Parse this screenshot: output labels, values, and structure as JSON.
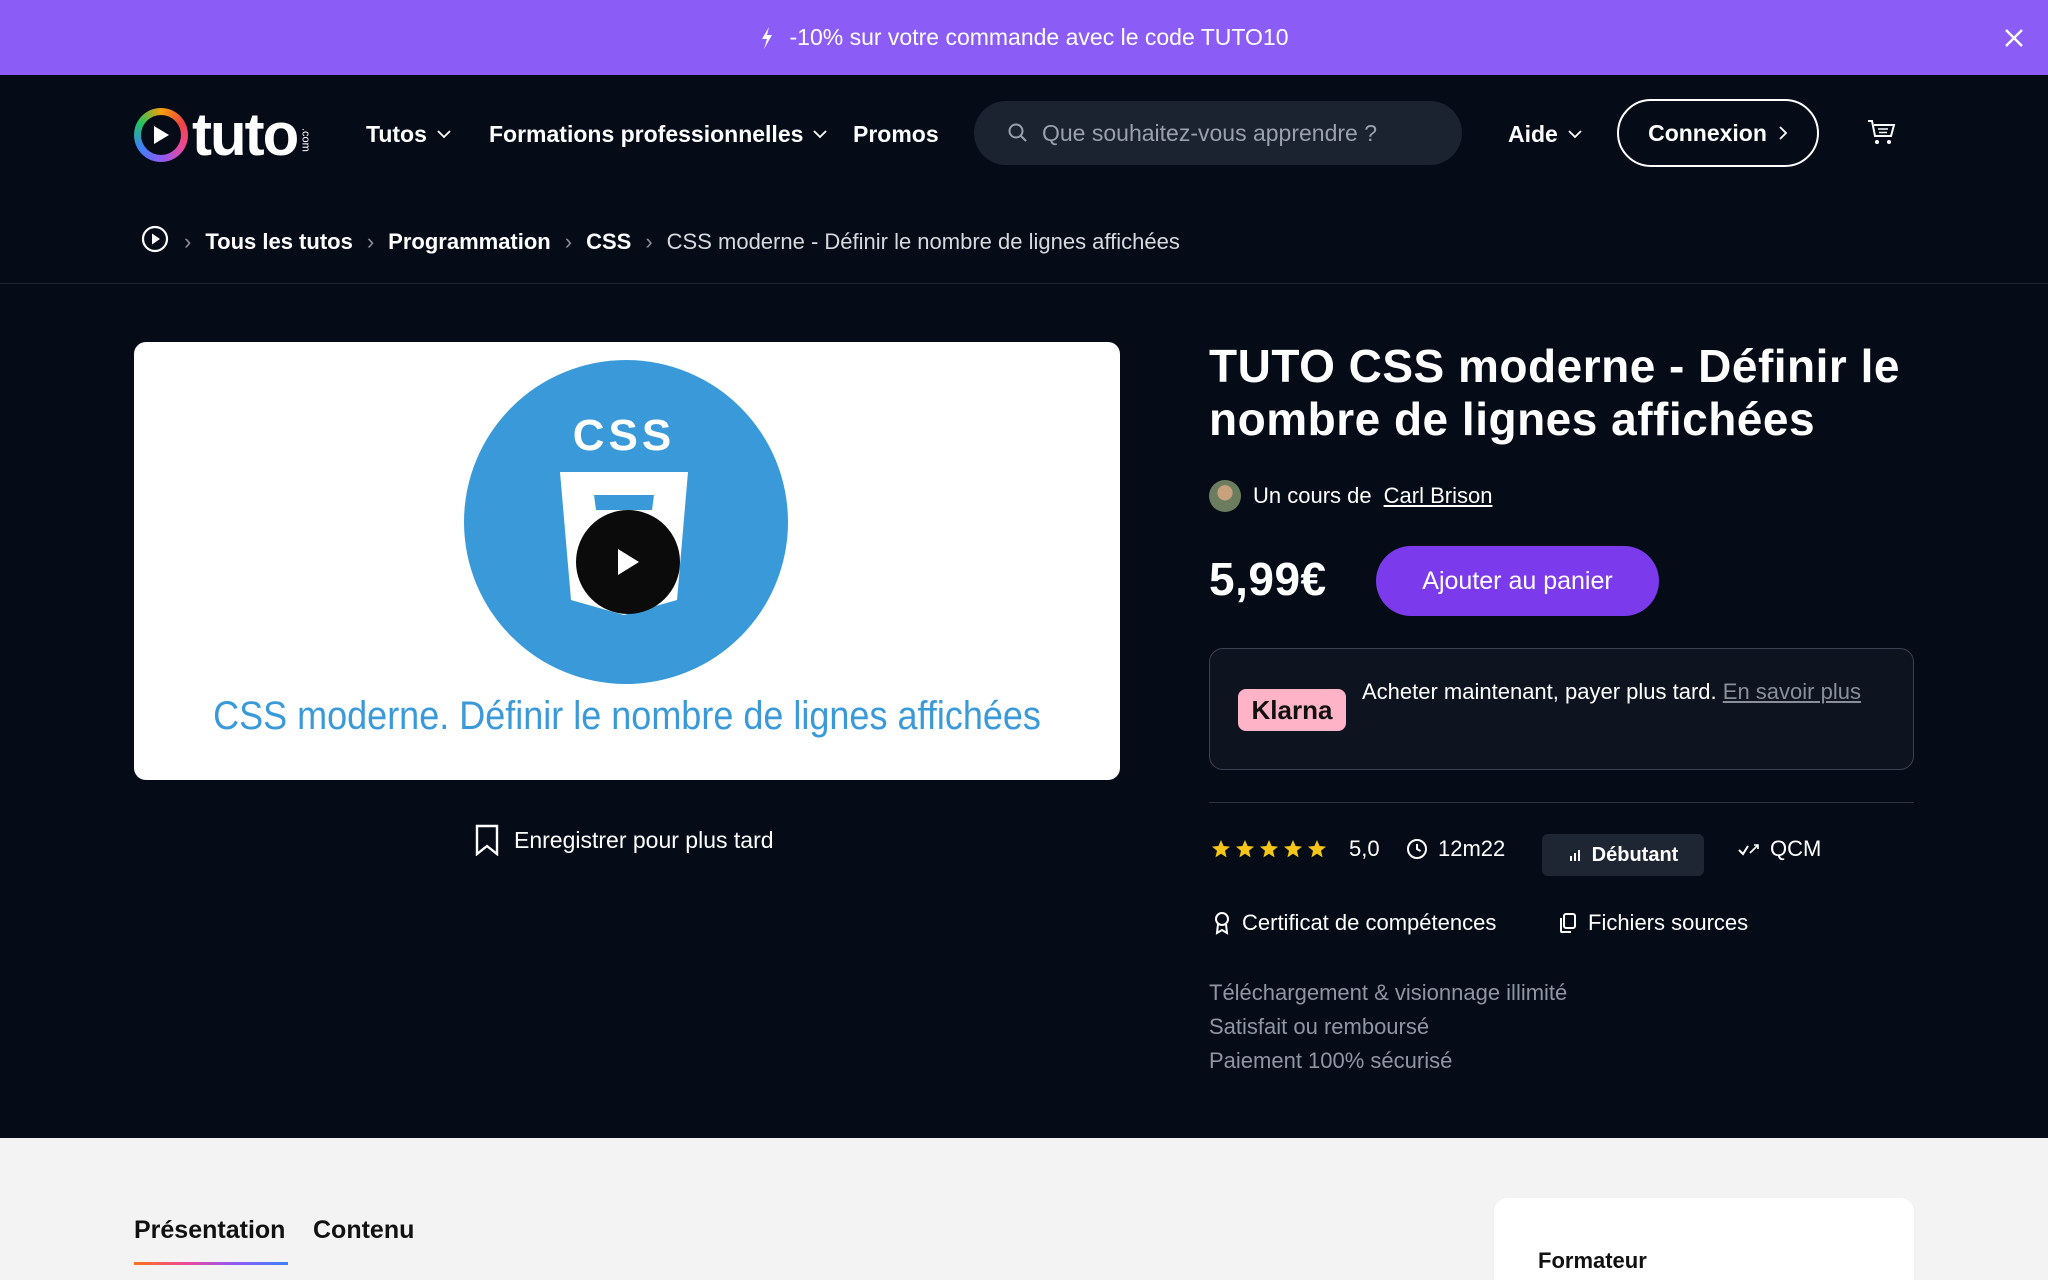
{
  "promo": {
    "text": "-10% sur votre commande avec le code TUTO10"
  },
  "header": {
    "logo_text": "tuto",
    "logo_suffix": ".com",
    "nav": {
      "tutos": "Tutos",
      "formations": "Formations professionnelles",
      "promos": "Promos",
      "aide": "Aide"
    },
    "search_placeholder": "Que souhaitez-vous apprendre ?",
    "login": "Connexion"
  },
  "breadcrumb": {
    "items": [
      "Tous les tutos",
      "Programmation",
      "CSS"
    ],
    "current": "CSS moderne - Définir le nombre de lignes affichées"
  },
  "video": {
    "badge_text": "CSS",
    "caption": "CSS moderne. Définir le nombre de lignes affichées"
  },
  "save_later": "Enregistrer pour plus tard",
  "course": {
    "title": "TUTO CSS moderne - Définir le nombre de lignes affichées",
    "author_prefix": "Un cours de",
    "author_name": "Carl Brison",
    "price": "5,99€",
    "add_to_cart": "Ajouter au panier",
    "klarna": {
      "badge": "Klarna",
      "text": "Acheter maintenant, payer plus tard.",
      "link": "En savoir plus"
    },
    "rating": "5,0",
    "rating_stars": 5,
    "duration": "12m22",
    "level": "Débutant",
    "qcm": "QCM",
    "certificate": "Certificat de compétences",
    "sources": "Fichiers sources",
    "perks": [
      "Téléchargement & visionnage illimité",
      "Satisfait ou remboursé",
      "Paiement 100% sécurisé"
    ]
  },
  "tabs": {
    "presentation": "Présentation",
    "contenu": "Contenu"
  },
  "trainer_card": {
    "label": "Formateur"
  },
  "colors": {
    "accent": "#7c3aed",
    "promo_bg": "#8b5cf6",
    "star": "#f5c518",
    "css_blue": "#3a9ad9"
  }
}
